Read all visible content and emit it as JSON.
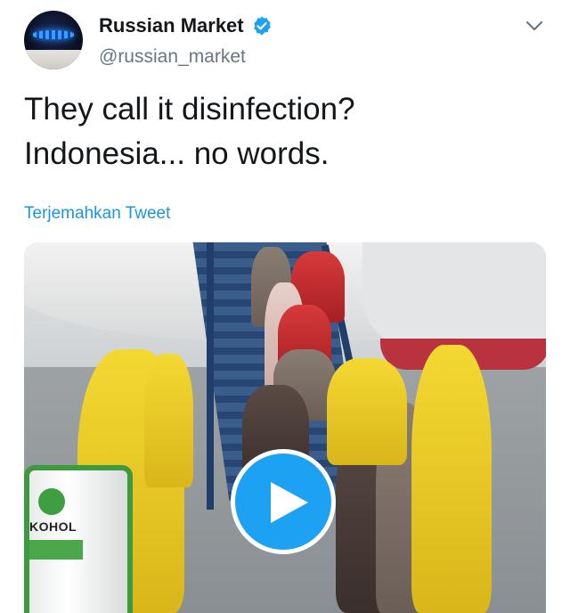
{
  "author": {
    "name": "Russian Market",
    "handle": "@russian_market",
    "verified": true
  },
  "tweet": {
    "lines": [
      "They call it disinfection?",
      "Indonesia... no words."
    ],
    "translate_label": "Terjemahkan Tweet"
  },
  "media": {
    "type": "video",
    "tank_label": "KOHOL",
    "play_icon": "play-icon"
  },
  "colors": {
    "accent": "#1da1f2",
    "link": "#1b95e0",
    "secondary_text": "#657786"
  }
}
